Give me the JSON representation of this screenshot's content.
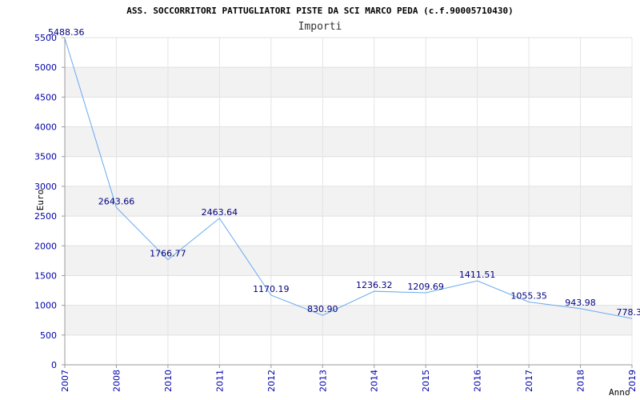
{
  "chart_data": {
    "type": "line",
    "title": "ASS. SOCCORRITORI PATTUGLIATORI PISTE DA SCI MARCO PEDA (c.f.90005710430)",
    "subtitle": "Importi",
    "xlabel": "Anno",
    "ylabel": "Euro",
    "categories": [
      "2007",
      "2008",
      "2010",
      "2011",
      "2012",
      "2013",
      "2014",
      "2015",
      "2016",
      "2017",
      "2018",
      "2019"
    ],
    "series": [
      {
        "values": [
          5488.36,
          2643.66,
          1766.77,
          2463.64,
          1170.19,
          830.9,
          1236.32,
          1209.69,
          1411.51,
          1055.35,
          943.98,
          778.3
        ],
        "labels": [
          "5488.36",
          "2643.66",
          "1766.77",
          "2463.64",
          "1170.19",
          "830.90",
          "1236.32",
          "1209.69",
          "1411.51",
          "1055.35",
          "943.98",
          "778.3"
        ],
        "color": "#66aaee"
      }
    ],
    "yticks": [
      "0",
      "500",
      "1000",
      "1500",
      "2000",
      "2500",
      "3000",
      "3500",
      "4000",
      "4500",
      "5000",
      "5500"
    ],
    "ylim": [
      0,
      5500
    ],
    "grid": true,
    "band_color": "#f2f2f2",
    "tick_color": "#0000aa",
    "label_color": "#000080"
  }
}
